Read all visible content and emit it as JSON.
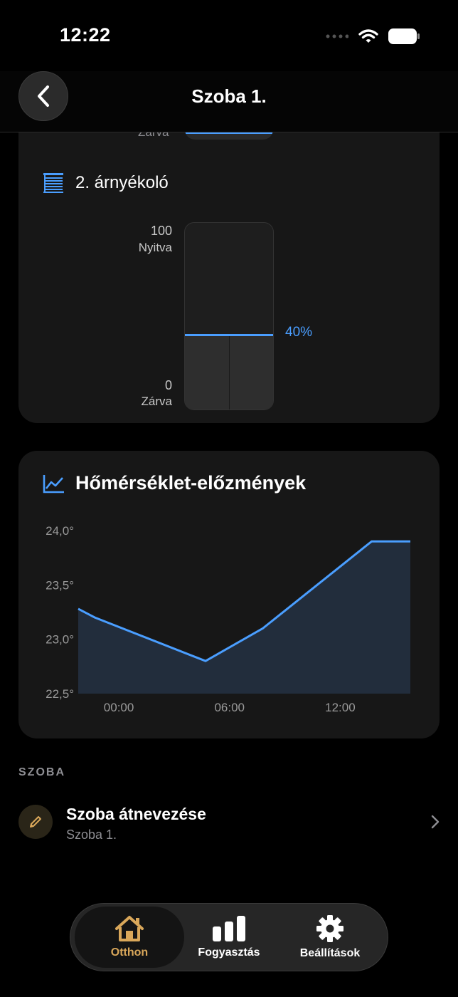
{
  "status_bar": {
    "time": "12:22"
  },
  "nav": {
    "title": "Szoba 1."
  },
  "previous_shade": {
    "closed_label": "Zárva"
  },
  "shade": {
    "title": "2. árnyékoló",
    "max_value": "100",
    "max_label": "Nyitva",
    "min_value": "0",
    "min_label": "Zárva",
    "position_percent": 40,
    "position_text": "40%"
  },
  "temperature": {
    "title": "Hőmérséklet-előzmények",
    "accent_color": "#4a9eff",
    "chart_data": {
      "type": "area",
      "title": "Hőmérséklet-előzmények",
      "y_ticks": [
        "24,0°",
        "23,5°",
        "23,0°",
        "22,5°"
      ],
      "x_ticks": [
        "00:00",
        "06:00",
        "12:00"
      ],
      "x_tick_hours": [
        0,
        6,
        12
      ],
      "ylim": [
        22.5,
        24.0
      ],
      "xlim": [
        -2.2,
        15.8
      ],
      "x": [
        -2.2,
        -1.3,
        4.7,
        7.8,
        13.7,
        15.8
      ],
      "y": [
        23.28,
        23.2,
        22.8,
        23.1,
        23.9,
        23.9
      ]
    }
  },
  "section": {
    "title": "SZOBA",
    "rename_title": "Szoba átnevezése",
    "rename_subtitle": "Szoba 1."
  },
  "tabs": [
    {
      "label": "Otthon",
      "icon": "house-icon",
      "active": true
    },
    {
      "label": "Fogyasztás",
      "icon": "bar-chart-icon",
      "active": false
    },
    {
      "label": "Beállítások",
      "icon": "gear-icon",
      "active": false
    }
  ],
  "colors": {
    "accent_gold": "#d9a75a",
    "accent_blue": "#4a9eff"
  }
}
